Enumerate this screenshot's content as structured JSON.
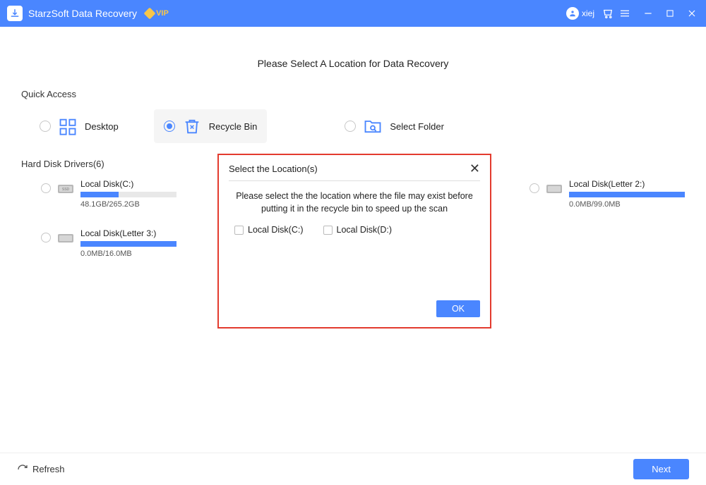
{
  "titlebar": {
    "app_name": "StarzSoft Data Recovery",
    "vip_label": "VIP",
    "user_name": "xiej"
  },
  "main": {
    "heading": "Please Select A Location for Data Recovery",
    "quick_access_label": "Quick Access",
    "quick_items": [
      {
        "label": "Desktop",
        "selected": false
      },
      {
        "label": "Recycle Bin",
        "selected": true
      },
      {
        "label": "Select Folder",
        "selected": false
      }
    ],
    "hard_disk_label": "Hard Disk Drivers(6)",
    "drives": [
      {
        "name": "Local Disk(C:)",
        "size": "48.1GB/265.2GB",
        "fill_pct": 40
      },
      {
        "name": "Local Disk(Letter 2:)",
        "size": "0.0MB/99.0MB",
        "fill_pct": 100
      },
      {
        "name": "Local Disk(Letter 3:)",
        "size": "0.0MB/16.0MB",
        "fill_pct": 100
      }
    ]
  },
  "modal": {
    "title": "Select the Location(s)",
    "message": "Please select the the location where the file may exist before putting it in the recycle bin to speed up the scan",
    "options": [
      {
        "label": "Local Disk(C:)"
      },
      {
        "label": "Local Disk(D:)"
      }
    ],
    "ok_label": "OK"
  },
  "footer": {
    "refresh_label": "Refresh",
    "next_label": "Next"
  }
}
